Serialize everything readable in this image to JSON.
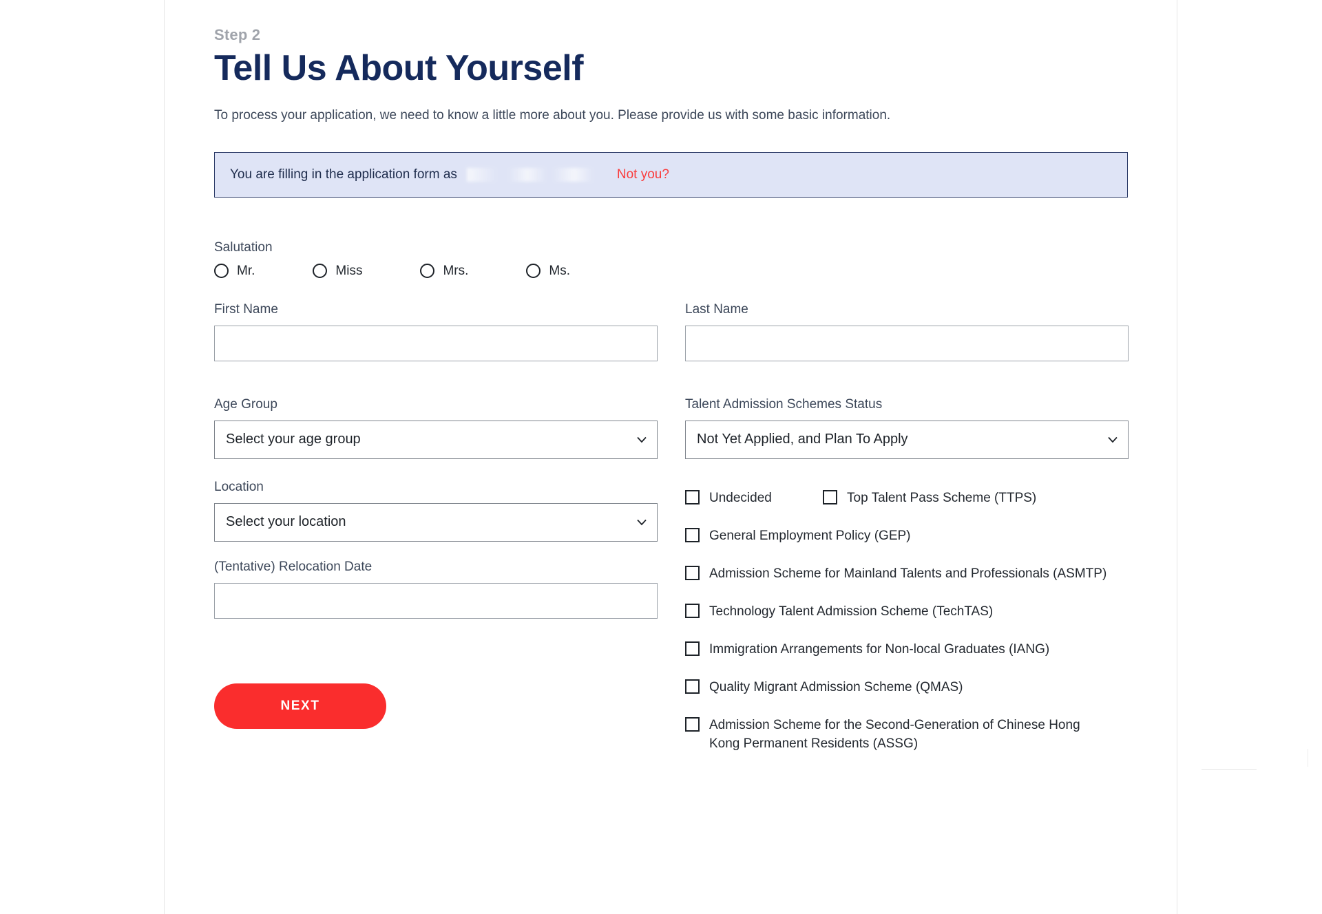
{
  "header": {
    "step_label": "Step 2",
    "title": "Tell Us About Yourself",
    "intro": "To process your application, we need to know a little more about you. Please provide us with some basic information."
  },
  "alert": {
    "text": "You are filling in the application form as",
    "redacted_name": "",
    "not_you_link": "Not you?",
    "background_color": "#dfe4f6",
    "border_color": "#2b3a67",
    "link_color": "#fa3c3c"
  },
  "form": {
    "salutation": {
      "label": "Salutation",
      "options": [
        {
          "label": "Mr.",
          "selected": false
        },
        {
          "label": "Miss",
          "selected": false
        },
        {
          "label": "Mrs.",
          "selected": false
        },
        {
          "label": "Ms.",
          "selected": false
        }
      ]
    },
    "first_name": {
      "label": "First Name",
      "value": "",
      "placeholder": ""
    },
    "last_name": {
      "label": "Last Name",
      "value": "",
      "placeholder": ""
    },
    "age_group": {
      "label": "Age Group",
      "selected": "Select your age group"
    },
    "talent_status": {
      "label": "Talent Admission Schemes Status",
      "selected": "Not Yet Applied, and Plan To Apply"
    },
    "location": {
      "label": "Location",
      "selected": "Select your location"
    },
    "relocation_date": {
      "label": "(Tentative) Relocation Date",
      "value": "",
      "placeholder": ""
    },
    "schemes": [
      {
        "label": "Undecided",
        "checked": false
      },
      {
        "label": "Top Talent Pass Scheme (TTPS)",
        "checked": false
      },
      {
        "label": "General Employment Policy (GEP)",
        "checked": false
      },
      {
        "label": "Admission Scheme for Mainland Talents and Professionals (ASMTP)",
        "checked": false
      },
      {
        "label": "Technology Talent Admission Scheme (TechTAS)",
        "checked": false
      },
      {
        "label": "Immigration Arrangements for Non-local Graduates (IANG)",
        "checked": false
      },
      {
        "label": "Quality Migrant Admission Scheme (QMAS)",
        "checked": false
      },
      {
        "label": "Admission Scheme for the Second-Generation of Chinese Hong Kong Permanent Residents (ASSG)",
        "checked": false
      }
    ]
  },
  "actions": {
    "next_label": "NEXT",
    "next_color": "#fa2d2d"
  }
}
